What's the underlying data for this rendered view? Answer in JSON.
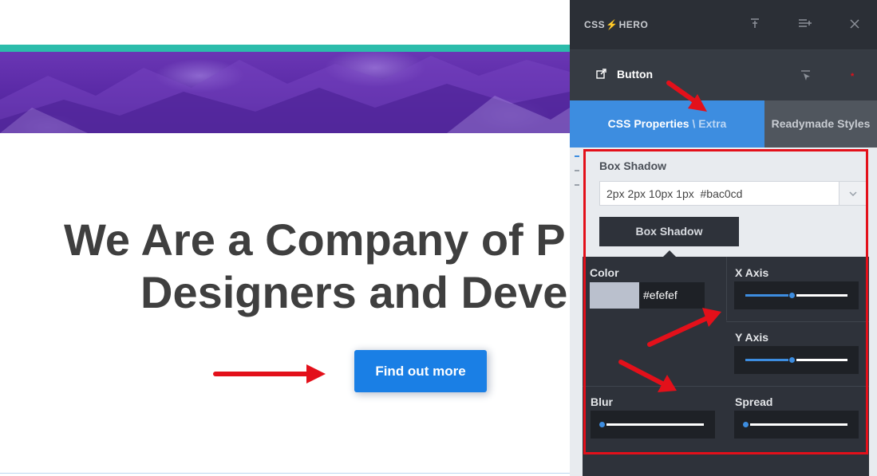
{
  "hero": {
    "headline_line1": "We Are a Company of P",
    "headline_line2": "Designers and Deve",
    "cta_label": "Find out more"
  },
  "panel": {
    "logo_left": "CSS",
    "logo_right": "HERO",
    "top_icons": [
      "pin-icon",
      "list-add-icon",
      "close-icon"
    ],
    "selected_element": "Button",
    "selected_icons": [
      "external-link-icon",
      "cursor-select-icon",
      "asterisk-icon"
    ],
    "tabs": {
      "active_main": "CSS Properties",
      "active_sep": " \\ ",
      "active_extra": "Extra",
      "inactive": "Readymade Styles"
    },
    "box_shadow": {
      "label": "Box Shadow",
      "value": "2px 2px 10px 1px  #bac0cd",
      "button_label": "Box Shadow"
    },
    "color": {
      "label": "Color",
      "value": "#efefef",
      "swatch": "#bac0cd"
    },
    "sliders": {
      "x_axis": {
        "label": "X Axis",
        "level": 0.45
      },
      "y_axis": {
        "label": "Y Axis",
        "level": 0.45
      },
      "blur": {
        "label": "Blur",
        "level": 0.0
      },
      "spread": {
        "label": "Spread",
        "level": 0.0
      }
    }
  },
  "colors": {
    "accent_blue": "#3d8de0",
    "button_blue": "#1a7fe5",
    "teal": "#2cbcab",
    "highlight_red": "#e3101a"
  }
}
